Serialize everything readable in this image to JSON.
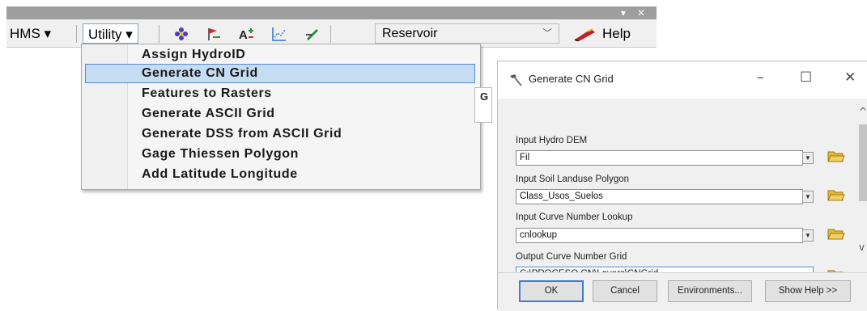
{
  "toolbar": {
    "window_buttons": {
      "dropdown": "▾",
      "close": "✕"
    },
    "menu_hms": "HMS ▾",
    "menu_utility": "Utility ▾",
    "tools": [
      {
        "icon": "flower-icon",
        "color": "#4a3fb5"
      },
      {
        "icon": "flag-pin-icon",
        "color": "#d22a2a"
      },
      {
        "icon": "text-plus-icon",
        "color": "#222222"
      },
      {
        "icon": "grid-chart-icon",
        "color": "#2a6fd2"
      },
      {
        "icon": "edit-pencil-icon",
        "color": "#2a8f3a"
      }
    ],
    "reservoir_select": "Reservoir",
    "help_label": "Help",
    "help_icon_color": "#c0202a"
  },
  "utility_menu": {
    "items": [
      "Assign HydroID",
      "Generate CN Grid",
      "Features to Rasters",
      "Generate ASCII Grid",
      "Generate DSS from ASCII Grid",
      "Gage Thiessen Polygon",
      "Add Latitude Longitude"
    ],
    "highlighted_index": 1,
    "side_tab_letter": "G"
  },
  "dialog": {
    "title": "Generate CN Grid",
    "window_buttons": {
      "minimize": "–",
      "maximize": "☐",
      "close": "✕"
    },
    "fields": [
      {
        "label": "Input Hydro DEM",
        "value": "Fil",
        "has_dropdown": true
      },
      {
        "label": "Input Soil Landuse Polygon",
        "value": "Class_Usos_Suelos",
        "has_dropdown": true
      },
      {
        "label": "Input Curve Number Lookup",
        "value": "cnlookup",
        "has_dropdown": true
      },
      {
        "label": "Output Curve Number Grid",
        "value": "C:\\PROCESO CN\\Layers\\CNGrid",
        "has_dropdown": false
      }
    ],
    "buttons": {
      "ok": "OK",
      "cancel": "Cancel",
      "environments": "Environments...",
      "show_help": "Show Help >>"
    },
    "scroll_up": "^",
    "scroll_down": "v",
    "folder_color": "#e0b83a",
    "accent": "#3c7fd1"
  }
}
